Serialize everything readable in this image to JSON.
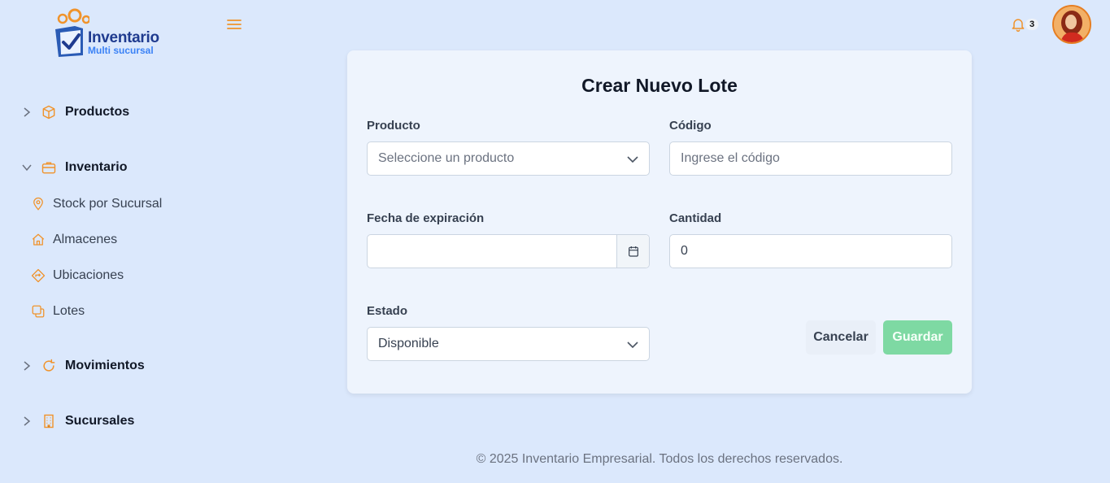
{
  "logo": {
    "title": "Inventario",
    "subtitle": "Multi sucursal"
  },
  "header": {
    "notification_count": "3"
  },
  "sidebar": {
    "groups": [
      {
        "label": "Productos"
      },
      {
        "label": "Inventario"
      },
      {
        "label": "Movimientos"
      },
      {
        "label": "Sucursales"
      }
    ],
    "inventario_items": [
      {
        "label": "Stock por Sucursal"
      },
      {
        "label": "Almacenes"
      },
      {
        "label": "Ubicaciones"
      },
      {
        "label": "Lotes"
      }
    ]
  },
  "form": {
    "title": "Crear Nuevo Lote",
    "producto": {
      "label": "Producto",
      "placeholder": "Seleccione un producto"
    },
    "codigo": {
      "label": "Código",
      "placeholder": "Ingrese el código"
    },
    "fecha": {
      "label": "Fecha de expiración",
      "value": ""
    },
    "cantidad": {
      "label": "Cantidad",
      "value": "0"
    },
    "estado": {
      "label": "Estado",
      "value": "Disponible"
    },
    "cancel_label": "Cancelar",
    "save_label": "Guardar"
  },
  "footer": {
    "text": "© 2025 Inventario Empresarial. Todos los derechos reservados."
  },
  "colors": {
    "accent": "#f0932b",
    "background": "#dbe8fc",
    "card": "#eef4fd",
    "save_button": "#7ed9a3",
    "brand_blue": "#1f3b8f"
  },
  "icons": [
    "logo-icon",
    "menu-icon",
    "bell-icon",
    "box-icon",
    "briefcase-icon",
    "refresh-icon",
    "building-icon",
    "map-pin-icon",
    "home-icon",
    "diamond-arrow-icon",
    "layers-icon",
    "calendar-icon",
    "chevron-down-icon",
    "chevron-right-icon"
  ]
}
